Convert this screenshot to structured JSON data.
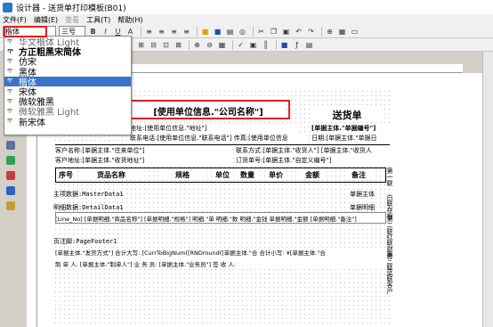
{
  "window": {
    "title": "设计器 - 送货单打印模板(B01)"
  },
  "menu": [
    "文件(F)",
    "编辑(E)",
    "查看",
    "工具(T)",
    "帮助(H)"
  ],
  "toolbar": {
    "font_value": "楷体",
    "size_value": "三号",
    "bold": "B",
    "italic": "I",
    "underline": "U"
  },
  "font_dropdown": {
    "items": [
      {
        "label": "华文楷体 Light",
        "style": "light"
      },
      {
        "label": "方正粗黑宋简体",
        "style": "bold"
      },
      {
        "label": "仿宋",
        "style": "normal"
      },
      {
        "label": "黑体",
        "style": "normal"
      },
      {
        "label": "楷体",
        "style": "selected"
      },
      {
        "label": "宋体",
        "style": "normal"
      },
      {
        "label": "微软雅黑",
        "style": "normal"
      },
      {
        "label": "微软雅黑 Light",
        "style": "light"
      },
      {
        "label": "新宋体",
        "style": "normal"
      }
    ]
  },
  "report": {
    "company_field": "[使用单位信息.\"公司名称\"]",
    "doc_title": "送货单",
    "address": "地址:[使用单位信息.\"地址\"]",
    "contact": "联系电话:[使用单位信息.\"联系电话\"] 传真:[使用单位信息",
    "order_no": "[单据主体.\"单据编号\"]",
    "date": "日期:[单据主体.\"单据日",
    "customer_name": "客户名称:[单据主体.\"往来单位\"]",
    "customer_addr": "客户地址:[单据主体.\"收货地址\"]",
    "contact_method": "联系方式:[单据主体.\"收货人\"] [单据主体.\"收货人",
    "order_ref": "订货单号:[单据主体.\"自定义编号\"]",
    "col_headers": [
      "序号",
      "货品名称",
      "规格",
      "单位",
      "数量",
      "单价",
      "金额",
      "备注"
    ],
    "master_band": "主项数据:MasterData1",
    "master_right": "单据主体",
    "detail_band": "明细数据:DetailData1",
    "detail_right": "单据明细",
    "detail_row": "[Line_No] [单据明细.\"商品名称\"] [单据明细.\"规格\"] 明细.\"单 明细.\"数 明细.\"金钱 单据明细.\"金额 [单据明细.\"备注\"]",
    "footer_band": "页注脚:PageFooter1",
    "footer_row1": "[单据主体.\"发货方式\"] 合计大写: [CurrToBigNum([RNDround([单据主体.\"合 合计小写: ¥[单据主体.\"合",
    "footer_row2": "制 单 人: [单据主体.\"制单人\"] 业 务 员: [单据主体.\"业务员\"] 签 收 人:",
    "side_labels": [
      "第一联",
      "白联存根",
      "第二联",
      "红联财务",
      "第三联",
      "蓝联客户"
    ]
  }
}
